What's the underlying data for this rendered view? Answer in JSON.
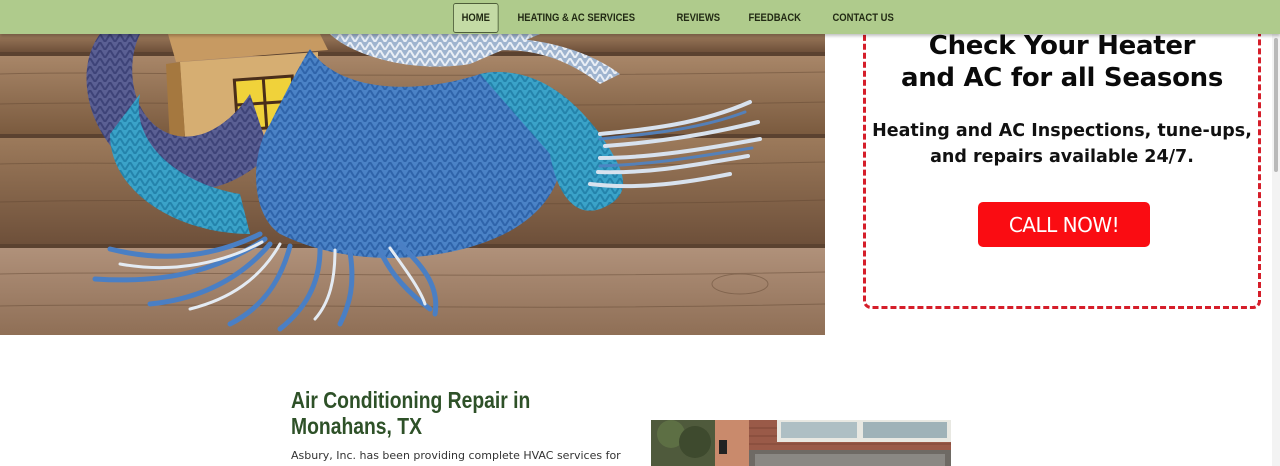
{
  "nav": {
    "items": [
      {
        "label": "HOME",
        "active": true
      },
      {
        "label": "HEATING & AC SERVICES"
      },
      {
        "label": "REVIEWS"
      },
      {
        "label": "FEEDBACK"
      },
      {
        "label": "CONTACT US"
      }
    ]
  },
  "promo": {
    "heading_line1": "Check Your Heater",
    "heading_line2": "and AC for all Seasons",
    "subtext_line1": "Heating and AC Inspections, tune-ups,",
    "subtext_line2": "and repairs available 24/7.",
    "cta_label": "CALL NOW!"
  },
  "section": {
    "title_line1": "Air Conditioning Repair in",
    "title_line2": "Monahans, TX",
    "body": "Asbury, Inc. has been providing complete HVAC services for"
  },
  "colors": {
    "nav_bg": "#afcb8c",
    "accent_red": "#fa0c12",
    "border_red": "#d51e2a",
    "title_green": "#2e5128"
  }
}
